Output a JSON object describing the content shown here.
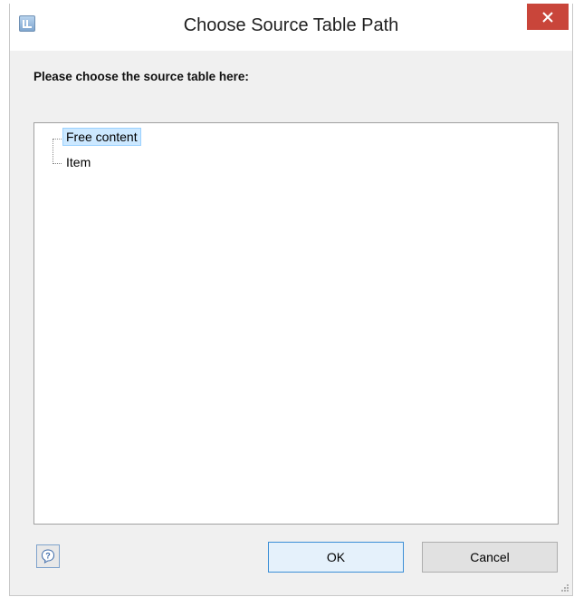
{
  "window": {
    "title": "Choose Source Table Path",
    "icon": "app-icon",
    "close_icon": "close-icon",
    "accent_close": "#c9453a"
  },
  "prompt": "Please choose the source table here:",
  "tree": {
    "items": [
      {
        "label": "Free content",
        "selected": true
      },
      {
        "label": "Item",
        "selected": false
      }
    ]
  },
  "buttons": {
    "help_icon": "help-icon",
    "ok_label": "OK",
    "cancel_label": "Cancel"
  }
}
